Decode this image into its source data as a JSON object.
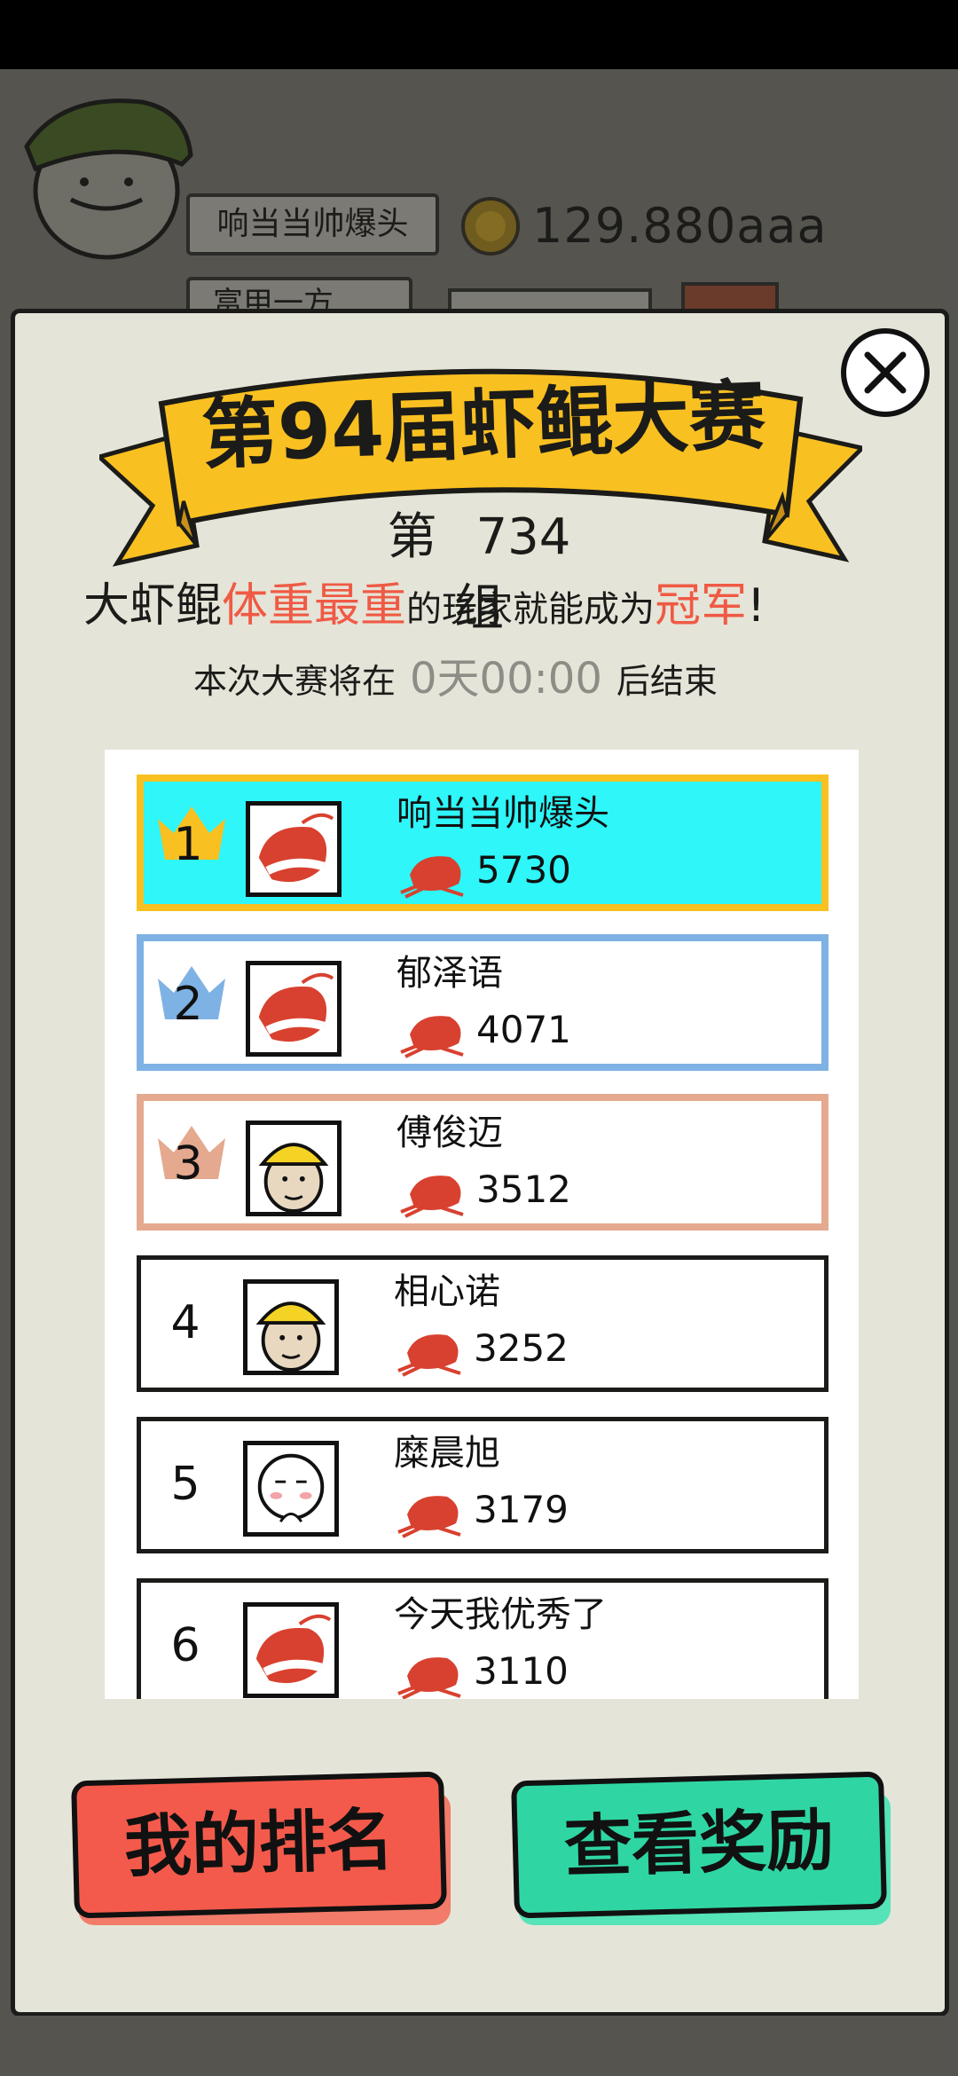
{
  "player": {
    "name": "响当当帅爆头",
    "coins": "129.880aaa",
    "title_partial": "富甲一方"
  },
  "contest": {
    "title": "第94届虾鲲大赛",
    "group_prefix": "第",
    "group_number": "734",
    "group_suffix": "组",
    "rule_part1": "大虾鲲",
    "rule_highlight1": "体重最重",
    "rule_part2": "的玩家就能成为",
    "rule_highlight2": "冠军",
    "rule_end": "!",
    "end_prefix": "本次大赛将在",
    "end_time": "0天00:00",
    "end_suffix": "后结束"
  },
  "leaderboard": [
    {
      "rank": "1",
      "name": "响当当帅爆头",
      "score": "5730",
      "avatar": "shrimp-avatar",
      "crown": "gold"
    },
    {
      "rank": "2",
      "name": "郁泽语",
      "score": "4071",
      "avatar": "shrimp-avatar",
      "crown": "blue"
    },
    {
      "rank": "3",
      "name": "傅俊迈",
      "score": "3512",
      "avatar": "helmet-man-avatar",
      "crown": "bronze"
    },
    {
      "rank": "4",
      "name": "相心诺",
      "score": "3252",
      "avatar": "helmet-man-avatar",
      "crown": ""
    },
    {
      "rank": "5",
      "name": "糜晨旭",
      "score": "3179",
      "avatar": "round-face-avatar",
      "crown": ""
    },
    {
      "rank": "6",
      "name": "今天我优秀了",
      "score": "3110",
      "avatar": "shrimp-avatar",
      "crown": ""
    }
  ],
  "buttons": {
    "my_rank": "我的排名",
    "view_rewards": "查看奖励"
  },
  "colors": {
    "first_bg": "#2ef6f9",
    "gold": "#f9c021",
    "silver_blue": "#7fb2e4",
    "bronze": "#e4a98e",
    "highlight_red": "#ef5a44",
    "button_red": "#f45a4b",
    "button_green": "#2fd6a3"
  }
}
